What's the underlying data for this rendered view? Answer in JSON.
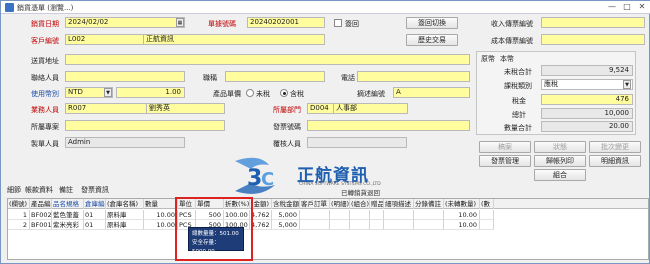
{
  "window": {
    "title": "銷貨憑單 (瀏覽...)",
    "min": "—",
    "max": "□",
    "close": "✕"
  },
  "header": {
    "sale_date_label": "銷貨日期",
    "sale_date": "2024/02/02",
    "doc_no_label": "單據號碼",
    "doc_no": "20240202001",
    "void_label": "簽回",
    "switch_btn": "簽回切換",
    "customer_label": "客戶編號",
    "customer_code": "L002",
    "customer_name": "正航資訊",
    "history_btn": "歷史交易",
    "receivable_label": "收入傳票編號",
    "cost_voucher_label": "成本傳票編號"
  },
  "info": {
    "address_label": "送貨地址",
    "contact_label": "聯絡人員",
    "title_label": "職稱",
    "phone_label": "電話",
    "currency_label": "使用幣別",
    "currency": "NTD",
    "rate": "1.00",
    "price_type_label": "產品單價",
    "untaxed_label": "未稅",
    "taxed_label": "含稅",
    "desc_code_label": "摘述編號",
    "desc_code": "A",
    "sales_label": "業務人員",
    "sales_code": "R007",
    "sales_name": "劉秀英",
    "dept_label": "所屬部門",
    "dept_code": "D004",
    "dept_name": "人事部",
    "project_label": "所屬專案",
    "invoice_label": "發票號碼",
    "creator_label": "製單人員",
    "creator": "Admin",
    "reviewer_label": "覆核人員"
  },
  "totals": {
    "tab_orig": "原幣",
    "tab_local": "本幣",
    "untaxed_total_label": "未稅合計",
    "untaxed_total": "9,524",
    "tax_type_label": "課稅類別",
    "tax_type": "應稅",
    "tax_label": "稅金",
    "tax": "476",
    "total_label": "總計",
    "total": "10,000",
    "qty_total_label": "數量合計",
    "qty_total": "20.00"
  },
  "side_buttons": {
    "b1": "稿案",
    "b2": "狀態",
    "b3": "批次變更",
    "b4": "發票管理",
    "b5": "歸帳列印",
    "b6": "明細資訊",
    "b7": "組合"
  },
  "tabs": [
    "細節",
    "帳款資料",
    "備註",
    "發票資訊"
  ],
  "watermark": {
    "brand": "正航資訊",
    "sub": "CHINA SOFTWARE SYSTEMS CO.,LTD",
    "cert": "已轉銷貨退回"
  },
  "grid": {
    "headers": [
      "(欄號)",
      "產品編號",
      "品名規格",
      "倉庫編號",
      "(倉庫名稱)",
      "數量",
      "單位",
      "單價",
      "折數(%)",
      "(金額)",
      "含稅金額",
      "客戶訂單",
      "(明細)",
      "(組合)",
      "贈品",
      "細項描述",
      "分錄備註",
      "(未轉數量)",
      "(數"
    ],
    "rows": [
      [
        "1",
        "BF002",
        "藍色筆蓋",
        "01",
        "原料庫",
        "10.00",
        "PCS",
        "500",
        "100.00",
        "4,762",
        "5,000",
        "",
        "",
        "",
        "",
        "",
        "",
        "10.00",
        ""
      ],
      [
        "2",
        "BF001",
        "紫米亮彩",
        "01",
        "原料庫",
        "10.00",
        "PCS",
        "500",
        "100.00",
        "4,762",
        "5,000",
        "",
        "",
        "",
        "",
        "",
        "",
        "10.00",
        ""
      ]
    ]
  },
  "popup": {
    "line1": "總數量量：501.00",
    "line2": "安全存量：5000.00"
  }
}
